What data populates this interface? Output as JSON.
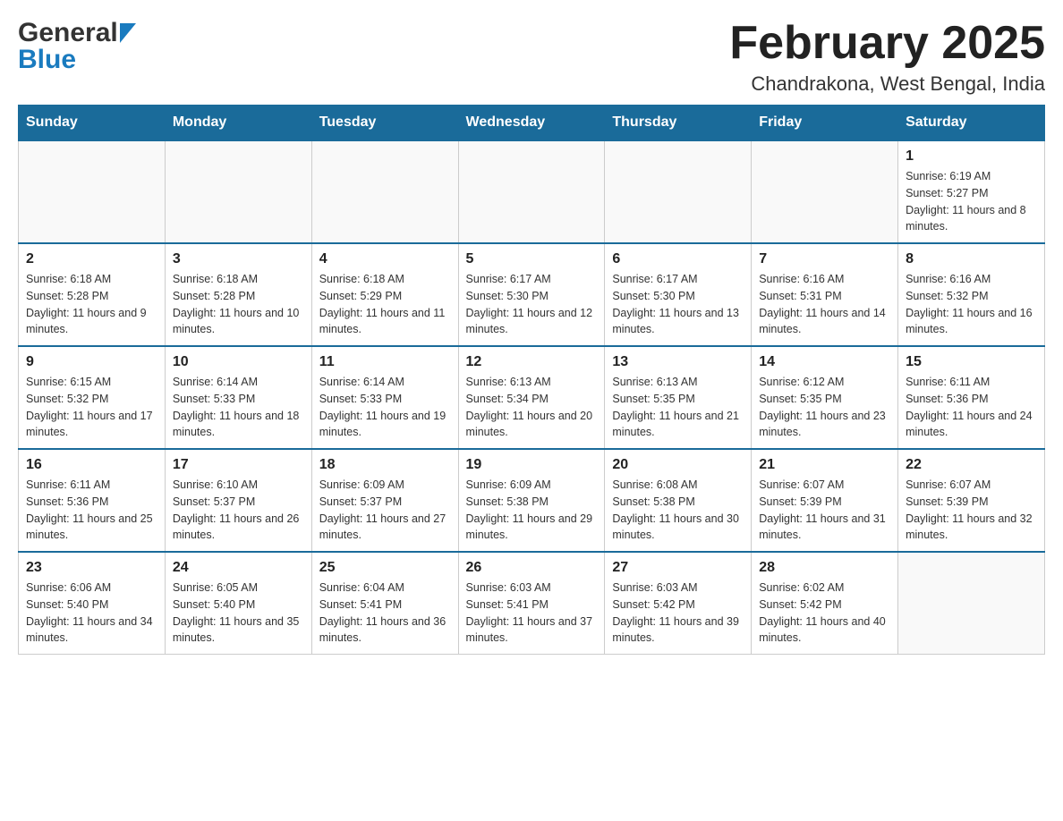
{
  "header": {
    "logo_general": "General",
    "logo_blue": "Blue",
    "title": "February 2025",
    "location": "Chandrakona, West Bengal, India"
  },
  "days_of_week": [
    "Sunday",
    "Monday",
    "Tuesday",
    "Wednesday",
    "Thursday",
    "Friday",
    "Saturday"
  ],
  "weeks": [
    [
      {
        "day": "",
        "info": ""
      },
      {
        "day": "",
        "info": ""
      },
      {
        "day": "",
        "info": ""
      },
      {
        "day": "",
        "info": ""
      },
      {
        "day": "",
        "info": ""
      },
      {
        "day": "",
        "info": ""
      },
      {
        "day": "1",
        "info": "Sunrise: 6:19 AM\nSunset: 5:27 PM\nDaylight: 11 hours and 8 minutes."
      }
    ],
    [
      {
        "day": "2",
        "info": "Sunrise: 6:18 AM\nSunset: 5:28 PM\nDaylight: 11 hours and 9 minutes."
      },
      {
        "day": "3",
        "info": "Sunrise: 6:18 AM\nSunset: 5:28 PM\nDaylight: 11 hours and 10 minutes."
      },
      {
        "day": "4",
        "info": "Sunrise: 6:18 AM\nSunset: 5:29 PM\nDaylight: 11 hours and 11 minutes."
      },
      {
        "day": "5",
        "info": "Sunrise: 6:17 AM\nSunset: 5:30 PM\nDaylight: 11 hours and 12 minutes."
      },
      {
        "day": "6",
        "info": "Sunrise: 6:17 AM\nSunset: 5:30 PM\nDaylight: 11 hours and 13 minutes."
      },
      {
        "day": "7",
        "info": "Sunrise: 6:16 AM\nSunset: 5:31 PM\nDaylight: 11 hours and 14 minutes."
      },
      {
        "day": "8",
        "info": "Sunrise: 6:16 AM\nSunset: 5:32 PM\nDaylight: 11 hours and 16 minutes."
      }
    ],
    [
      {
        "day": "9",
        "info": "Sunrise: 6:15 AM\nSunset: 5:32 PM\nDaylight: 11 hours and 17 minutes."
      },
      {
        "day": "10",
        "info": "Sunrise: 6:14 AM\nSunset: 5:33 PM\nDaylight: 11 hours and 18 minutes."
      },
      {
        "day": "11",
        "info": "Sunrise: 6:14 AM\nSunset: 5:33 PM\nDaylight: 11 hours and 19 minutes."
      },
      {
        "day": "12",
        "info": "Sunrise: 6:13 AM\nSunset: 5:34 PM\nDaylight: 11 hours and 20 minutes."
      },
      {
        "day": "13",
        "info": "Sunrise: 6:13 AM\nSunset: 5:35 PM\nDaylight: 11 hours and 21 minutes."
      },
      {
        "day": "14",
        "info": "Sunrise: 6:12 AM\nSunset: 5:35 PM\nDaylight: 11 hours and 23 minutes."
      },
      {
        "day": "15",
        "info": "Sunrise: 6:11 AM\nSunset: 5:36 PM\nDaylight: 11 hours and 24 minutes."
      }
    ],
    [
      {
        "day": "16",
        "info": "Sunrise: 6:11 AM\nSunset: 5:36 PM\nDaylight: 11 hours and 25 minutes."
      },
      {
        "day": "17",
        "info": "Sunrise: 6:10 AM\nSunset: 5:37 PM\nDaylight: 11 hours and 26 minutes."
      },
      {
        "day": "18",
        "info": "Sunrise: 6:09 AM\nSunset: 5:37 PM\nDaylight: 11 hours and 27 minutes."
      },
      {
        "day": "19",
        "info": "Sunrise: 6:09 AM\nSunset: 5:38 PM\nDaylight: 11 hours and 29 minutes."
      },
      {
        "day": "20",
        "info": "Sunrise: 6:08 AM\nSunset: 5:38 PM\nDaylight: 11 hours and 30 minutes."
      },
      {
        "day": "21",
        "info": "Sunrise: 6:07 AM\nSunset: 5:39 PM\nDaylight: 11 hours and 31 minutes."
      },
      {
        "day": "22",
        "info": "Sunrise: 6:07 AM\nSunset: 5:39 PM\nDaylight: 11 hours and 32 minutes."
      }
    ],
    [
      {
        "day": "23",
        "info": "Sunrise: 6:06 AM\nSunset: 5:40 PM\nDaylight: 11 hours and 34 minutes."
      },
      {
        "day": "24",
        "info": "Sunrise: 6:05 AM\nSunset: 5:40 PM\nDaylight: 11 hours and 35 minutes."
      },
      {
        "day": "25",
        "info": "Sunrise: 6:04 AM\nSunset: 5:41 PM\nDaylight: 11 hours and 36 minutes."
      },
      {
        "day": "26",
        "info": "Sunrise: 6:03 AM\nSunset: 5:41 PM\nDaylight: 11 hours and 37 minutes."
      },
      {
        "day": "27",
        "info": "Sunrise: 6:03 AM\nSunset: 5:42 PM\nDaylight: 11 hours and 39 minutes."
      },
      {
        "day": "28",
        "info": "Sunrise: 6:02 AM\nSunset: 5:42 PM\nDaylight: 11 hours and 40 minutes."
      },
      {
        "day": "",
        "info": ""
      }
    ]
  ]
}
